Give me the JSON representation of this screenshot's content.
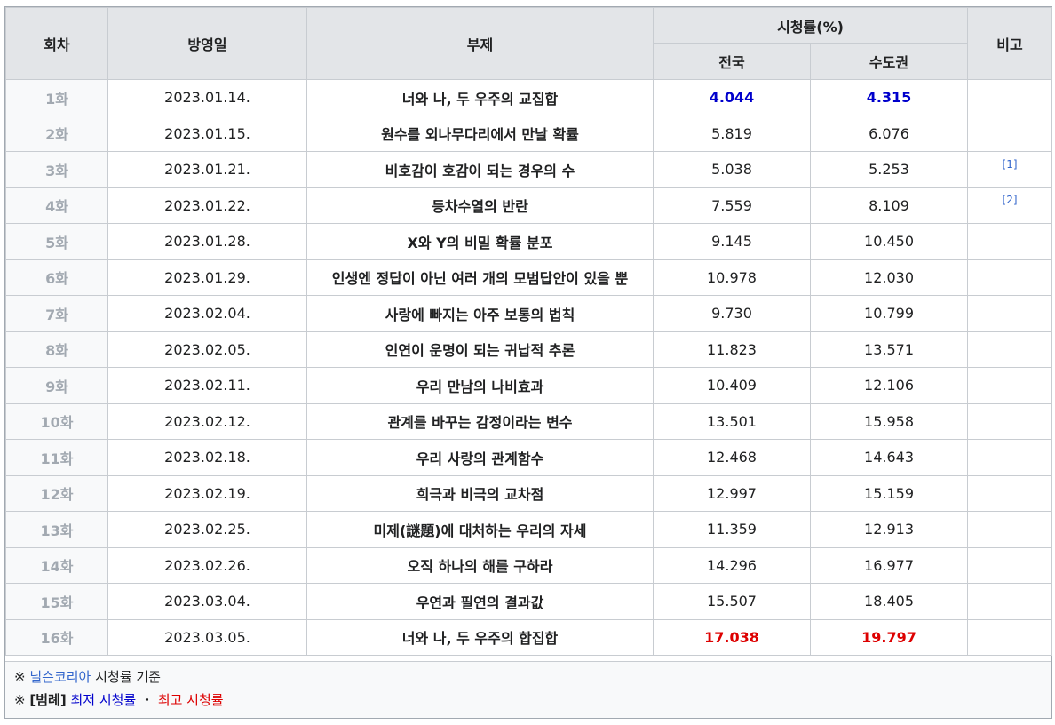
{
  "header": {
    "episode": "회차",
    "airdate": "방영일",
    "subtitle": "부제",
    "ratings": "시청률(%)",
    "nationwide": "전국",
    "capital": "수도권",
    "notes": "비고"
  },
  "rows": [
    {
      "ep": "1화",
      "date": "2023.01.14.",
      "subtitle": "너와 나, 두 우주의 교집합",
      "nation": "4.044",
      "capital": "4.315",
      "note": ""
    },
    {
      "ep": "2화",
      "date": "2023.01.15.",
      "subtitle": "원수를 외나무다리에서 만날 확률",
      "nation": "5.819",
      "capital": "6.076",
      "note": ""
    },
    {
      "ep": "3화",
      "date": "2023.01.21.",
      "subtitle": "비호감이 호감이 되는 경우의 수",
      "nation": "5.038",
      "capital": "5.253",
      "note": "[1]"
    },
    {
      "ep": "4화",
      "date": "2023.01.22.",
      "subtitle": "등차수열의 반란",
      "nation": "7.559",
      "capital": "8.109",
      "note": "[2]"
    },
    {
      "ep": "5화",
      "date": "2023.01.28.",
      "subtitle": "X와 Y의 비밀 확률 분포",
      "nation": "9.145",
      "capital": "10.450",
      "note": ""
    },
    {
      "ep": "6화",
      "date": "2023.01.29.",
      "subtitle": "인생엔 정답이 아닌 여러 개의 모범답안이 있을 뿐",
      "nation": "10.978",
      "capital": "12.030",
      "note": ""
    },
    {
      "ep": "7화",
      "date": "2023.02.04.",
      "subtitle": "사랑에 빠지는 아주 보통의 법칙",
      "nation": "9.730",
      "capital": "10.799",
      "note": ""
    },
    {
      "ep": "8화",
      "date": "2023.02.05.",
      "subtitle": "인연이 운명이 되는 귀납적 추론",
      "nation": "11.823",
      "capital": "13.571",
      "note": ""
    },
    {
      "ep": "9화",
      "date": "2023.02.11.",
      "subtitle": "우리 만남의 나비효과",
      "nation": "10.409",
      "capital": "12.106",
      "note": ""
    },
    {
      "ep": "10화",
      "date": "2023.02.12.",
      "subtitle": "관계를 바꾸는 감정이라는 변수",
      "nation": "13.501",
      "capital": "15.958",
      "note": ""
    },
    {
      "ep": "11화",
      "date": "2023.02.18.",
      "subtitle": "우리 사랑의 관계함수",
      "nation": "12.468",
      "capital": "14.643",
      "note": ""
    },
    {
      "ep": "12화",
      "date": "2023.02.19.",
      "subtitle": "희극과 비극의 교차점",
      "nation": "12.997",
      "capital": "15.159",
      "note": ""
    },
    {
      "ep": "13화",
      "date": "2023.02.25.",
      "subtitle": "미제(謎題)에 대처하는 우리의 자세",
      "nation": "11.359",
      "capital": "12.913",
      "note": ""
    },
    {
      "ep": "14화",
      "date": "2023.02.26.",
      "subtitle": "오직 하나의 해를 구하라",
      "nation": "14.296",
      "capital": "16.977",
      "note": ""
    },
    {
      "ep": "15화",
      "date": "2023.03.04.",
      "subtitle": "우연과 필연의 결과값",
      "nation": "15.507",
      "capital": "18.405",
      "note": ""
    },
    {
      "ep": "16화",
      "date": "2023.03.05.",
      "subtitle": "너와 나, 두 우주의 합집합",
      "nation": "17.038",
      "capital": "19.797",
      "note": ""
    }
  ],
  "min_row": 0,
  "max_row": 15,
  "footer": {
    "mark1": "※",
    "source_link": "닐슨코리아",
    "source_text": "시청률 기준",
    "mark2": "※",
    "legend_label": "[범례]",
    "lowest": "최저 시청률",
    "separator": "・",
    "highest": "최고 시청률"
  },
  "colors": {
    "lowest": "#0000cc",
    "highest": "#dd0000",
    "link": "#3366cc",
    "header_bg": "#e3e5e8"
  }
}
